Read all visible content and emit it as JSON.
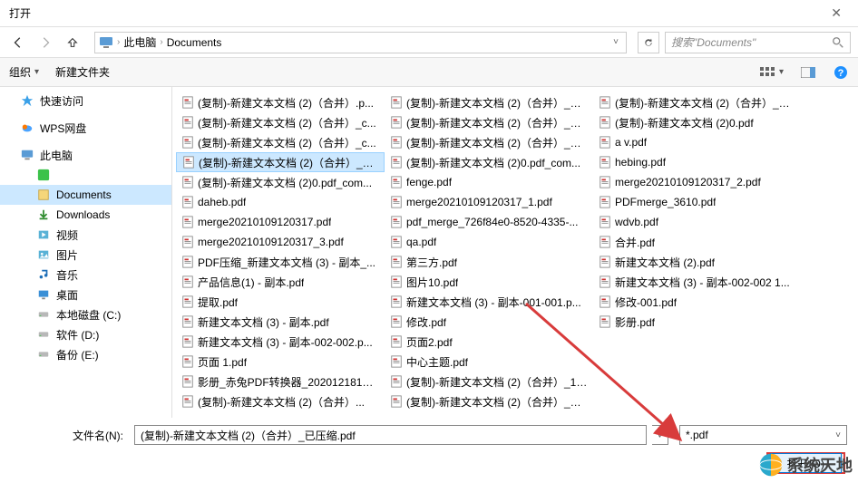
{
  "window": {
    "title": "打开"
  },
  "nav": {
    "crumb1": "此电脑",
    "crumb2": "Documents",
    "search_placeholder": "搜索\"Documents\""
  },
  "toolbar": {
    "organize": "组织",
    "newfolder": "新建文件夹"
  },
  "sidebar": {
    "quick": "快速访问",
    "wps": "WPS网盘",
    "thispc": "此电脑",
    "items": [
      {
        "label": "Documents",
        "selected": true
      },
      {
        "label": "Downloads"
      },
      {
        "label": "视频"
      },
      {
        "label": "图片"
      },
      {
        "label": "音乐"
      },
      {
        "label": "桌面"
      },
      {
        "label": "本地磁盘 (C:)"
      },
      {
        "label": "软件 (D:)"
      },
      {
        "label": "备份 (E:)"
      }
    ]
  },
  "files": {
    "col1": [
      {
        "name": "(复制)-新建文本文档 (2)（合并）.p..."
      },
      {
        "name": "(复制)-新建文本文档 (2)（合并）_c..."
      },
      {
        "name": "(复制)-新建文本文档 (2)（合并）_c..."
      },
      {
        "name": "(复制)-新建文本文档 (2)（合并）_已...",
        "selected": true
      },
      {
        "name": "(复制)-新建文本文档 (2)0.pdf_com..."
      },
      {
        "name": "daheb.pdf"
      },
      {
        "name": "merge20210109120317.pdf"
      },
      {
        "name": "merge20210109120317_3.pdf"
      },
      {
        "name": "PDF压缩_新建文本文档 (3) - 副本_..."
      },
      {
        "name": "产品信息(1) - 副本.pdf"
      },
      {
        "name": "提取.pdf"
      },
      {
        "name": "新建文本文档 (3) - 副本.pdf"
      },
      {
        "name": "新建文本文档 (3) - 副本-002-002.p..."
      },
      {
        "name": "页面 1.pdf"
      },
      {
        "name": "影册_赤兔PDF转换器_20201218102..."
      }
    ],
    "col2": [
      {
        "name": "(复制)-新建文本文档 (2)（合并）..."
      },
      {
        "name": "(复制)-新建文本文档 (2)（合并）_加..."
      },
      {
        "name": "(复制)-新建文本文档 (2)（合并）_加..."
      },
      {
        "name": "(复制)-新建文本文档 (2)（合并）_已..."
      },
      {
        "name": "(复制)-新建文本文档 (2)0.pdf_com..."
      },
      {
        "name": "fenge.pdf"
      },
      {
        "name": "merge20210109120317_1.pdf"
      },
      {
        "name": "pdf_merge_726f84e0-8520-4335-..."
      },
      {
        "name": "qa.pdf"
      },
      {
        "name": "第三方.pdf"
      },
      {
        "name": "图片10.pdf"
      },
      {
        "name": "新建文本文档 (3) - 副本-001-001.p..."
      },
      {
        "name": "修改.pdf"
      },
      {
        "name": "页面2.pdf"
      },
      {
        "name": "中心主题.pdf"
      }
    ],
    "col3": [
      {
        "name": "(复制)-新建文本文档 (2)（合并）_1...."
      },
      {
        "name": "(复制)-新建文本文档 (2)（合并）_加..."
      },
      {
        "name": "(复制)-新建文本文档 (2)（合并）_加..."
      },
      {
        "name": "(复制)-新建文本文档 (2)0.pdf"
      },
      {
        "name": "a v.pdf"
      },
      {
        "name": "hebing.pdf"
      },
      {
        "name": "merge20210109120317_2.pdf"
      },
      {
        "name": "PDFmerge_3610.pdf"
      },
      {
        "name": "wdvb.pdf"
      },
      {
        "name": "合并.pdf"
      },
      {
        "name": "新建文本文档 (2).pdf"
      },
      {
        "name": "新建文本文档 (3) - 副本-002-002 1..."
      },
      {
        "name": "修改-001.pdf"
      },
      {
        "name": "影册.pdf"
      }
    ]
  },
  "footer": {
    "filename_label": "文件名(N):",
    "filename_value": "(复制)-新建文本文档 (2)（合并）_已压缩.pdf",
    "filter": "*.pdf",
    "open": "打开(O)"
  },
  "watermark": "系统天地"
}
